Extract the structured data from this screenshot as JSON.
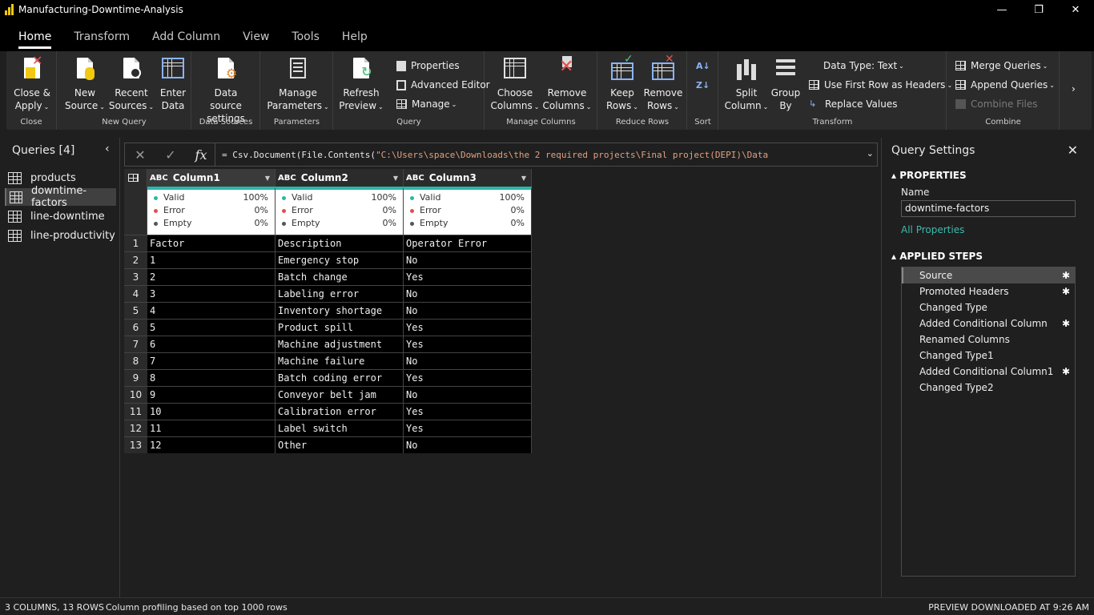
{
  "window": {
    "title": "Manufacturing-Downtime-Analysis",
    "controls": [
      "—",
      "❐",
      "✕"
    ]
  },
  "tabs": [
    "Home",
    "Transform",
    "Add Column",
    "View",
    "Tools",
    "Help"
  ],
  "ribbon": {
    "close": {
      "btn1_l1": "Close &",
      "btn1_l2": "Apply",
      "label": "Close"
    },
    "newquery": {
      "new_l1": "New",
      "new_l2": "Source",
      "recent_l1": "Recent",
      "recent_l2": "Sources",
      "enter_l1": "Enter",
      "enter_l2": "Data",
      "label": "New Query"
    },
    "datasources": {
      "btn_l1": "Data source",
      "btn_l2": "settings",
      "label": "Data Sources"
    },
    "parameters": {
      "btn_l1": "Manage",
      "btn_l2": "Parameters",
      "label": "Parameters"
    },
    "query": {
      "refresh_l1": "Refresh",
      "refresh_l2": "Preview",
      "properties": "Properties",
      "advanced": "Advanced Editor",
      "manage": "Manage",
      "label": "Query"
    },
    "managecols": {
      "choose_l1": "Choose",
      "choose_l2": "Columns",
      "remove_l1": "Remove",
      "remove_l2": "Columns",
      "label": "Manage Columns"
    },
    "reducerows": {
      "keep_l1": "Keep",
      "keep_l2": "Rows",
      "remove_l1": "Remove",
      "remove_l2": "Rows",
      "label": "Reduce Rows"
    },
    "sort": {
      "label": "Sort"
    },
    "transform": {
      "split_l1": "Split",
      "split_l2": "Column",
      "group_l1": "Group",
      "group_l2": "By",
      "datatype": "Data Type: Text",
      "firstrow": "Use First Row as Headers",
      "replace": "Replace Values",
      "label": "Transform"
    },
    "combine": {
      "merge": "Merge Queries",
      "append": "Append Queries",
      "combinefiles": "Combine Files",
      "label": "Combine"
    }
  },
  "queries": {
    "header": "Queries [4]",
    "items": [
      "products",
      "downtime-factors",
      "line-downtime",
      "line-productivity"
    ],
    "selected": 1
  },
  "formula": {
    "prefix": "= Csv.Document(File.Contents(",
    "string": "\"C:\\Users\\space\\Downloads\\the 2 required projects\\Final project(DEPI)\\Data"
  },
  "table": {
    "columns": [
      "Column1",
      "Column2",
      "Column3"
    ],
    "type_badge": "ABC",
    "quality": {
      "valid_label": "Valid",
      "error_label": "Error",
      "empty_label": "Empty",
      "valid": "100%",
      "error": "0%",
      "empty": "0%"
    },
    "rows": [
      [
        "Factor",
        "Description",
        "Operator Error"
      ],
      [
        "1",
        "Emergency stop",
        "No"
      ],
      [
        "2",
        "Batch change",
        "Yes"
      ],
      [
        "3",
        "Labeling error",
        "No"
      ],
      [
        "4",
        "Inventory shortage",
        "No"
      ],
      [
        "5",
        "Product spill",
        "Yes"
      ],
      [
        "6",
        "Machine adjustment",
        "Yes"
      ],
      [
        "7",
        "Machine failure",
        "No"
      ],
      [
        "8",
        "Batch coding error",
        "Yes"
      ],
      [
        "9",
        "Conveyor belt jam",
        "No"
      ],
      [
        "10",
        "Calibration error",
        "Yes"
      ],
      [
        "11",
        "Label switch",
        "Yes"
      ],
      [
        "12",
        "Other",
        "No"
      ]
    ]
  },
  "settings": {
    "title": "Query Settings",
    "properties_header": "PROPERTIES",
    "name_label": "Name",
    "name_value": "downtime-factors",
    "all_properties": "All Properties",
    "steps_header": "APPLIED STEPS",
    "steps": [
      {
        "name": "Source",
        "gear": true
      },
      {
        "name": "Promoted Headers",
        "gear": true
      },
      {
        "name": "Changed Type",
        "gear": false
      },
      {
        "name": "Added Conditional Column",
        "gear": true
      },
      {
        "name": "Renamed Columns",
        "gear": false
      },
      {
        "name": "Changed Type1",
        "gear": false
      },
      {
        "name": "Added Conditional Column1",
        "gear": true
      },
      {
        "name": "Changed Type2",
        "gear": false
      }
    ]
  },
  "status": {
    "left": "3 COLUMNS, 13 ROWS",
    "middle": "Column profiling based on top 1000 rows",
    "right": "PREVIEW DOWNLOADED AT 9:26 AM"
  },
  "colors": {
    "accent": "#2ab7a9",
    "valid_dot": "#2ab7a9",
    "error_dot": "#e05050",
    "empty_dot": "#555555",
    "link": "#3fb9ad",
    "logo": "#f2c811"
  }
}
